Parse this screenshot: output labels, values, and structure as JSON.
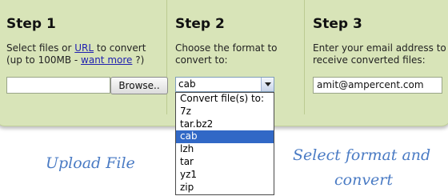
{
  "step1": {
    "title": "Step 1",
    "text_prefix": "Select files or ",
    "url_link": "URL",
    "text_suffix": " to convert",
    "line2_prefix": "(up to 100MB - ",
    "want_more_link": "want more",
    "line2_suffix": " ?)",
    "file_value": "",
    "browse_label": "Browse.."
  },
  "step2": {
    "title": "Step 2",
    "line1": "Choose the format to",
    "line2": "convert to:",
    "selected_value": "cab",
    "options": [
      {
        "label": "Convert file(s) to:"
      },
      {
        "label": "7z"
      },
      {
        "label": "tar.bz2"
      },
      {
        "label": "cab",
        "selected": true
      },
      {
        "label": "lzh"
      },
      {
        "label": "tar"
      },
      {
        "label": "yz1"
      },
      {
        "label": "zip"
      }
    ]
  },
  "step3": {
    "title": "Step 3",
    "line1": "Enter your email address to",
    "line2": "receive converted files:",
    "email_value": "amit@ampercent.com"
  },
  "annotations": {
    "upload": "Upload File",
    "select_line1": "Select format and",
    "select_line2": "convert"
  },
  "colors": {
    "panel": "#d8e4b8",
    "link": "#1f1fb0",
    "selection": "#3168c6",
    "annotation": "#4a7bc4"
  }
}
